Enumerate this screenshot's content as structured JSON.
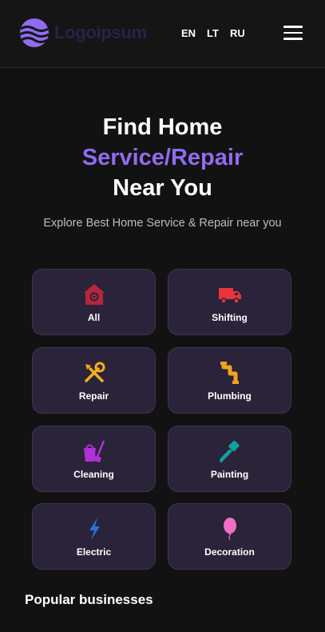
{
  "header": {
    "logo_text": "Logoipsum",
    "languages": [
      "EN",
      "LT",
      "RU"
    ],
    "menu_icon": "hamburger-menu-icon"
  },
  "hero": {
    "line1": "Find Home",
    "line2": "Service/Repair",
    "line3": "Near You",
    "subtitle": "Explore Best Home Service & Repair near you"
  },
  "categories": [
    {
      "label": "All",
      "icon": "house-gear-icon",
      "color": "#b5263e"
    },
    {
      "label": "Shifting",
      "icon": "truck-icon",
      "color": "#e8343a"
    },
    {
      "label": "Repair",
      "icon": "tools-icon",
      "color": "#f2b01e"
    },
    {
      "label": "Plumbing",
      "icon": "pipe-icon",
      "color": "#f5a21b"
    },
    {
      "label": "Cleaning",
      "icon": "cleaning-bucket-icon",
      "color": "#b031d6"
    },
    {
      "label": "Painting",
      "icon": "paint-brush-icon",
      "color": "#11a0a0"
    },
    {
      "label": "Electric",
      "icon": "lightning-bolt-icon",
      "color": "#2c6fd6"
    },
    {
      "label": "Decoration",
      "icon": "balloon-icon",
      "color": "#f06ec3"
    }
  ],
  "popular": {
    "title": "Popular businesses"
  },
  "colors": {
    "accent": "#8f6cf0",
    "background": "#121212",
    "card_bg": "#2a2339"
  }
}
